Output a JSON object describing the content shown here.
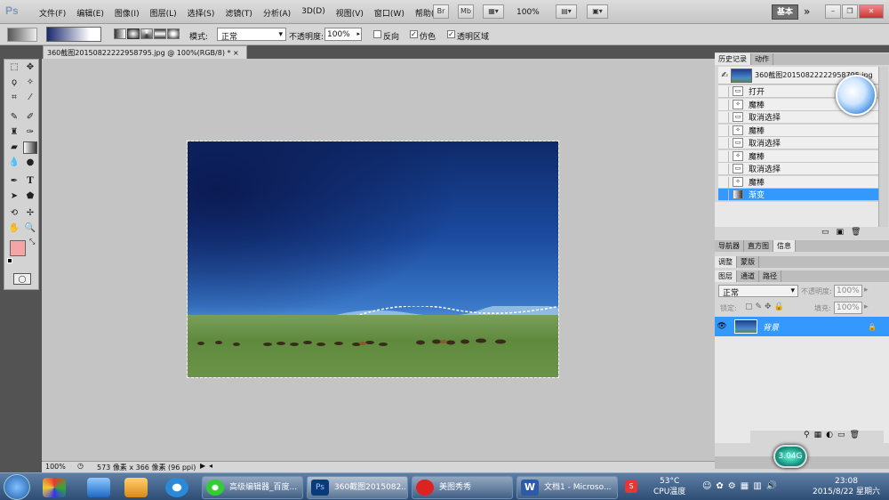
{
  "app": {
    "logo": "Ps"
  },
  "menu": [
    "文件(F)",
    "编辑(E)",
    "图像(I)",
    "图层(L)",
    "选择(S)",
    "滤镜(T)",
    "分析(A)",
    "3D(D)",
    "视图(V)",
    "窗口(W)",
    "帮助(H)"
  ],
  "appbar": {
    "zoom": "100%",
    "workspace": "基本"
  },
  "options": {
    "mode_label": "模式:",
    "mode_value": "正常",
    "opacity_label": "不透明度:",
    "opacity_value": "100%",
    "reverse": "反向",
    "dither": "仿色",
    "transparency": "透明区域"
  },
  "document": {
    "tab_title": "360截图20150822222958795.jpg @ 100%(RGB/8) *",
    "status_zoom": "100%",
    "status_size": "573 像素 x 366 像素 (96 ppi)"
  },
  "history": {
    "tabs": [
      "历史记录",
      "动作"
    ],
    "snapshot": "360截图20150822222958795.jpg",
    "items": [
      "打开",
      "魔棒",
      "取消选择",
      "魔棒",
      "取消选择",
      "魔棒",
      "取消选择",
      "魔棒",
      "渐变"
    ]
  },
  "panels": {
    "nav_tabs": [
      "导航器",
      "直方图",
      "信息"
    ],
    "adj_tabs": [
      "调整",
      "蒙版"
    ],
    "layers_tabs": [
      "图层",
      "通道",
      "路径"
    ],
    "blend_mode": "正常",
    "opacity_label": "不透明度:",
    "opacity_value": "100%",
    "lock_label": "锁定:",
    "fill_label": "填充:",
    "fill_value": "100%",
    "layer_name": "背景"
  },
  "taskbar": {
    "tasks": [
      "高级编辑器_百度...",
      "360截图2015082...",
      "美图秀秀",
      "文档1 - Microso..."
    ],
    "cpu_temp": "53°C",
    "cpu_label": "CPU温度",
    "time": "23:08",
    "date": "2015/8/22 星期六",
    "badge": "3.04G"
  },
  "colors": {
    "selection": "#3399ff",
    "fg_swatch": "#f4a6a6",
    "bg_swatch": "#ffffff"
  }
}
